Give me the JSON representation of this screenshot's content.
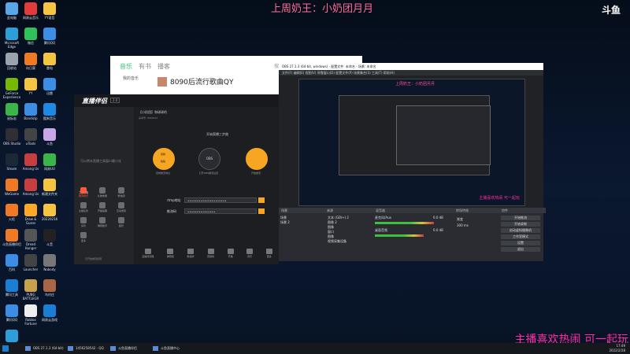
{
  "overlay": {
    "top_caption": "上周奶王：小奶团月月",
    "corner_logo": "斗鱼",
    "bottom_caption": "主播喜欢热闹 可一起玩"
  },
  "desktop_icons": [
    {
      "label": "此电脑",
      "color": "#5aa7e8"
    },
    {
      "label": "网易云音乐",
      "color": "#e33b3b"
    },
    {
      "label": "YY语音",
      "color": "#f5c542"
    },
    {
      "label": "Microsoft Edge",
      "color": "#2d9fd8"
    },
    {
      "label": "微信",
      "color": "#2fc25b"
    },
    {
      "label": "腾讯QQ",
      "color": "#3a8ee6"
    },
    {
      "label": "回收站",
      "color": "#9aa3ad"
    },
    {
      "label": "向日葵",
      "color": "#f07a24"
    },
    {
      "label": "雷电",
      "color": "#f5c542"
    },
    {
      "label": "GeForce Experience",
      "color": "#76b900"
    },
    {
      "label": "YY",
      "color": "#f5c542"
    },
    {
      "label": "迅雷",
      "color": "#3a8ee6"
    },
    {
      "label": "鼠标宏",
      "color": "#3ab54a"
    },
    {
      "label": "Bandizip",
      "color": "#3a8ee6"
    },
    {
      "label": "酷狗音乐",
      "color": "#1e88e5"
    },
    {
      "label": "OBS Studio",
      "color": "#302f33"
    },
    {
      "label": "uTools",
      "color": "#444"
    },
    {
      "label": "斗鱼",
      "color": "#c9a6e8"
    },
    {
      "label": "Steam",
      "color": "#1b2838"
    },
    {
      "label": "Among Us",
      "color": "#c83d3d"
    },
    {
      "label": "网易UU",
      "color": "#3ab54a"
    },
    {
      "label": "WeGame",
      "color": "#f07a24"
    },
    {
      "label": "Among Us",
      "color": "#c83d3d"
    },
    {
      "label": "新建文件夹",
      "color": "#f5c542"
    },
    {
      "label": "火炬",
      "color": "#f07a24"
    },
    {
      "label": "Draw & Guess",
      "color": "#ffa726"
    },
    {
      "label": "20220216",
      "color": "#f5c542"
    },
    {
      "label": "斗鱼直播伴侣",
      "color": "#f07a24"
    },
    {
      "label": "Dread Hunger",
      "color": "#555"
    },
    {
      "label": "斗音",
      "color": "#222"
    },
    {
      "label": "百科",
      "color": "#3a8ee6"
    },
    {
      "label": "Launcher",
      "color": "#444"
    },
    {
      "label": "Nobody",
      "color": "#777"
    },
    {
      "label": "腾讯工具",
      "color": "#1a7fd4"
    },
    {
      "label": "PUBG BATTLEGR",
      "color": "#c9a14a"
    },
    {
      "label": "鸟村庄",
      "color": "#aa6644"
    },
    {
      "label": "腾讯QQ",
      "color": "#3a8ee6"
    },
    {
      "label": "Roblox Fortune",
      "color": "#eee"
    },
    {
      "label": "网易云游戏",
      "color": "#1a7fd4"
    },
    {
      "label": "Wallpaper Engine",
      "color": "#2d9fd8"
    }
  ],
  "music_window": {
    "tabs": [
      "音乐",
      "有书",
      "播客"
    ],
    "user": "我的音乐",
    "song_title": "8090后流行歌曲QY",
    "search_placeholder": "搜索"
  },
  "obs_window": {
    "title": "OBS 27.1.3 (64-bit, windows) - 配置文件: 未命名 - 场景: 未命名",
    "menu": "文件(F)  编辑(E)  视图(V)  停靠窗口(D)  配置文件(P)  场景集合(S)  工具(T)  帮助(H)",
    "preview_caption": "上周奶王：小奶团月月",
    "preview_bottom_caption": "主播喜欢热闹 可一起玩",
    "dock_headers": [
      "场景",
      "来源",
      "混音器",
      "转场特效",
      "控件"
    ],
    "scenes": [
      "场景",
      "场景 2"
    ],
    "sources": [
      "文本 (GDI+) 2",
      "图像 2",
      "图像",
      "窗口",
      "图像",
      "视频采集设备"
    ],
    "mixer": [
      {
        "label": "麦克风/Aux",
        "level": "0.0 dB",
        "fill": 0.78
      },
      {
        "label": "桌面音频",
        "level": "0.0 dB",
        "fill": 0.65
      }
    ],
    "transition": "渐变",
    "duration": "300 ms",
    "controls": [
      "开始推流",
      "开始录制",
      "启动虚拟摄像机",
      "工作室模式",
      "设置",
      "退出"
    ]
  },
  "streaming_tool": {
    "logo": "直播伴侣",
    "version": "2.0",
    "room_name": "【小奶团】和球球的",
    "room_id": "房间号: 8068252",
    "side_hint": "可以将本直播工具窗口最小化",
    "section": "工具箱",
    "tools": [
      "推流模式",
      "礼物效果",
      "粉丝团",
      "主播任务",
      "开播提醒",
      "互动游戏",
      "房管",
      "弹幕助手",
      "超管",
      "更多"
    ],
    "active_tool_index": 0,
    "step_title": "开始直播三步曲",
    "steps": [
      "复制推流地址",
      "打开OBS推流设置",
      "开始推流"
    ],
    "step_buttons": [
      "复制",
      "粘贴"
    ],
    "step_center": "OBS",
    "inputs": [
      {
        "label": "rtmp地址",
        "value": "•••••••••••••••••••••"
      },
      {
        "label": "推流码",
        "value": "•••••••••••••••"
      }
    ],
    "bottom_tools": [
      "直播间管理",
      "弹幕姬",
      "粉丝牌",
      "贡献榜",
      "开播",
      "音乐",
      "更多"
    ],
    "footer": "已开启推流权限"
  },
  "taskbar": {
    "tasks": [
      {
        "label": "OBS 27.1.3 (64-bit)"
      },
      {
        "label": "1456258542 - QQ"
      },
      {
        "label": "斗鱼直播伴侣"
      },
      {
        "label": "斗鱼直播中心"
      }
    ],
    "time": "17:49",
    "date": "2022/2/28"
  }
}
